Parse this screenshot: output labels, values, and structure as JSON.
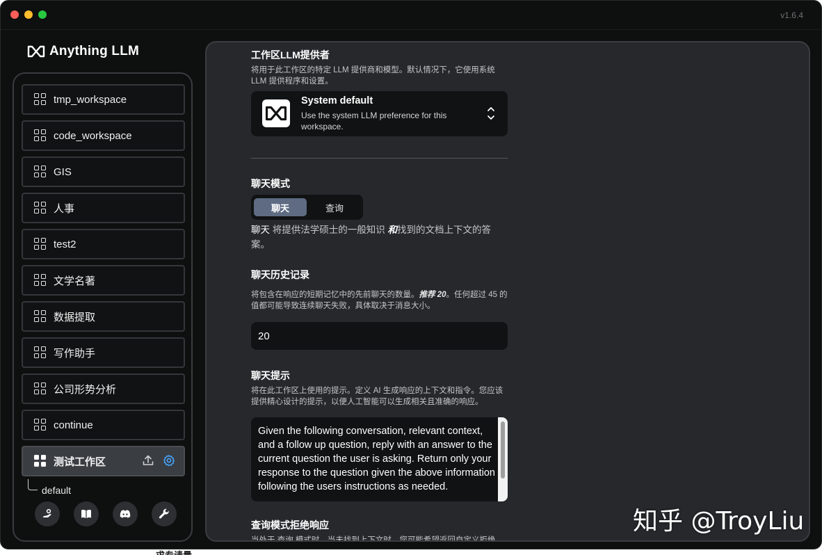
{
  "app": {
    "version": "v1.6.4",
    "brand": "Anything LLM"
  },
  "sidebar": {
    "workspaces": [
      {
        "label": "tmp_workspace"
      },
      {
        "label": "code_workspace"
      },
      {
        "label": "GIS"
      },
      {
        "label": "人事"
      },
      {
        "label": "test2"
      },
      {
        "label": "文学名著"
      },
      {
        "label": "数据提取"
      },
      {
        "label": "写作助手"
      },
      {
        "label": "公司形势分析"
      },
      {
        "label": "continue"
      },
      {
        "label": "测试工作区",
        "active": true
      }
    ],
    "active_thread": "default",
    "bottom_icons": [
      "community-hub-icon",
      "docs-book-icon",
      "discord-icon",
      "wrench-icon"
    ]
  },
  "settings": {
    "llm_provider": {
      "title": "工作区LLM提供者",
      "description": "将用于此工作区的特定 LLM 提供商和模型。默认情况下，它使用系统 LLM 提供程序和设置。",
      "selected_name": "System default",
      "selected_desc": "Use the system LLM preference for this workspace."
    },
    "chat_mode": {
      "title": "聊天模式",
      "options": [
        "聊天",
        "查询"
      ],
      "selected": "聊天",
      "desc_prefix": "聊天",
      "desc_middle": " 将提供法学硕士的一般知识 ",
      "desc_emph": "和",
      "desc_suffix": "找到的文档上下文的答案。"
    },
    "chat_history": {
      "title": "聊天历史记录",
      "desc_a": "将包含在响应的短期记忆中的先前聊天的数量。",
      "desc_emph": "推荐 20",
      "desc_b": "。任何超过 45 的值都可能导致连续聊天失败，具体取决于消息大小。",
      "value": "20"
    },
    "chat_prompt": {
      "title": "聊天提示",
      "description": "将在此工作区上使用的提示。定义 AI 生成响应的上下文和指令。您应该提供精心设计的提示，以便人工智能可以生成相关且准确的响应。",
      "value": "Given the following conversation, relevant context, and a follow up question, reply with an answer to the current question the user is asking. Return only your response to the question given the above information following the users instructions as needed."
    },
    "query_refusal": {
      "title": "查询模式拒绝响应",
      "description": "当处于 查询 模式时，当未找到上下文时，您可能希望返回自定义拒绝"
    }
  },
  "watermark": "知乎 @TroyLiu",
  "below_window_text": "求专请量"
}
